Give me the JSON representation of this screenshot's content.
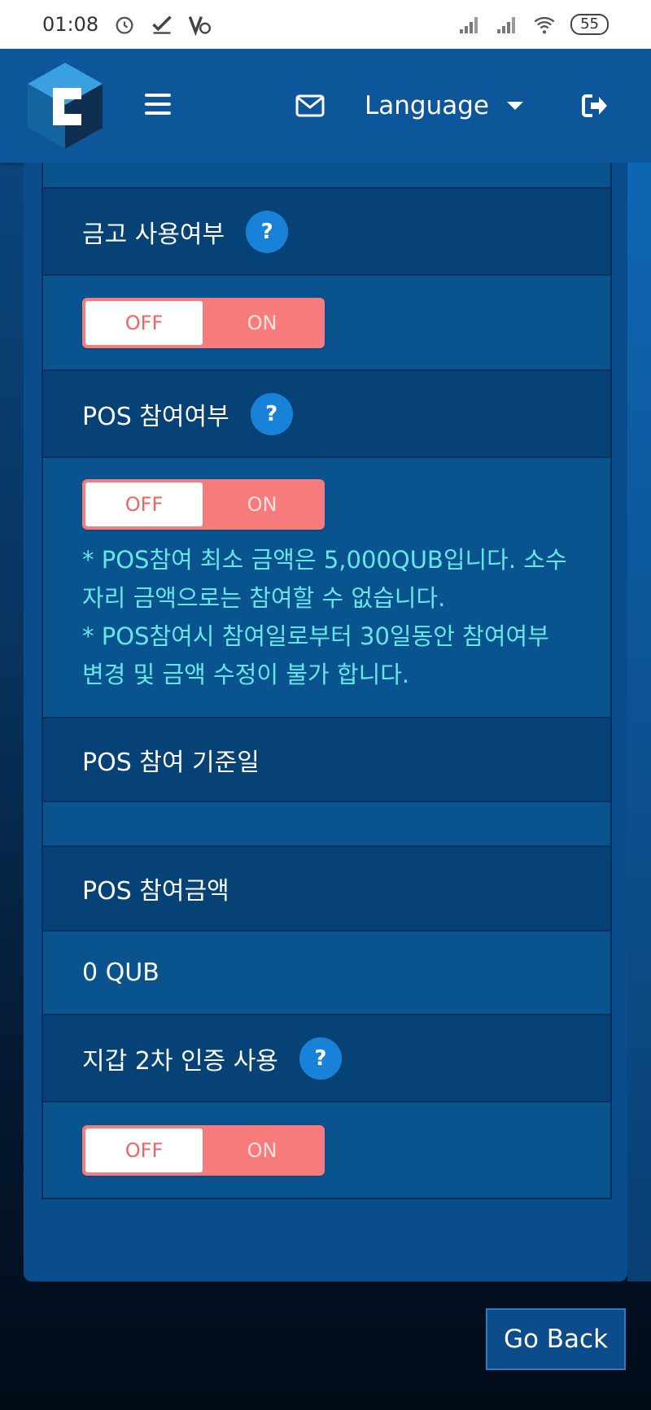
{
  "status_bar": {
    "time": "01:08",
    "battery": "55"
  },
  "header": {
    "language_label": "Language"
  },
  "settings": {
    "vault_label": "금고 사용여부",
    "vault_toggle": {
      "off": "OFF",
      "on": "ON"
    },
    "pos_label": "POS 참여여부",
    "pos_toggle": {
      "off": "OFF",
      "on": "ON"
    },
    "pos_note_1": "* POS참여 최소 금액은 5,000QUB입니다. 소수자리 금액으로는 참여할 수 없습니다.",
    "pos_note_2": "* POS참여시 참여일로부터 30일동안 참여여부 변경 및 금액 수정이 불가 합니다.",
    "pos_base_date_label": "POS 참여 기준일",
    "pos_base_date_value": "",
    "pos_amount_label": "POS 참여금액",
    "pos_amount_value": "0 QUB",
    "wallet_2fa_label": "지갑 2차 인증 사용",
    "wallet_2fa_toggle": {
      "off": "OFF",
      "on": "ON"
    },
    "help_glyph": "?"
  },
  "footer": {
    "go_back": "Go Back"
  },
  "colors": {
    "header": "#0d5699",
    "toggle": "#f77b7b",
    "note": "#66e6e6",
    "help": "#1882d8"
  }
}
